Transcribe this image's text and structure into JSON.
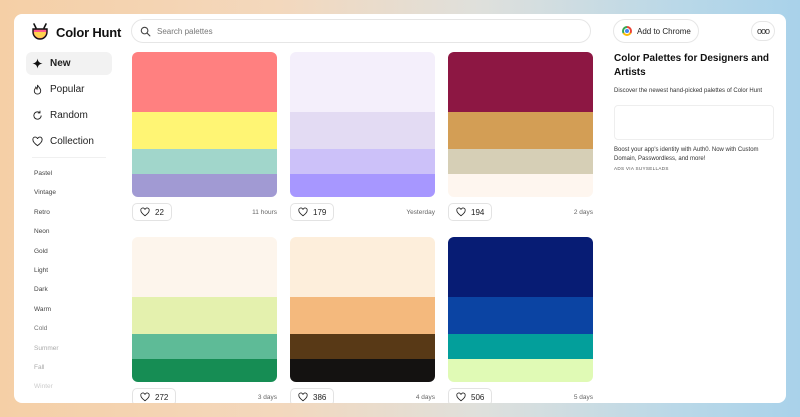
{
  "app": {
    "name": "Color Hunt"
  },
  "search": {
    "placeholder": "Search palettes"
  },
  "header": {
    "chrome_button": "Add to Chrome",
    "more_label": "ooo"
  },
  "sidebar": {
    "nav": [
      {
        "label": "New",
        "icon": "sparkle-icon",
        "active": true
      },
      {
        "label": "Popular",
        "icon": "flame-icon"
      },
      {
        "label": "Random",
        "icon": "refresh-icon"
      },
      {
        "label": "Collection",
        "icon": "heart-icon"
      }
    ],
    "tags": [
      "Pastel",
      "Vintage",
      "Retro",
      "Neon",
      "Gold",
      "Light",
      "Dark",
      "Warm",
      "Cold",
      "Summer",
      "Fall",
      "Winter"
    ]
  },
  "palettes": [
    {
      "colors": [
        "#ff8080",
        "#fff574",
        "#a1d6cb",
        "#a19ad3"
      ],
      "likes": "22",
      "time": "11 hours"
    },
    {
      "colors": [
        "#f4effb",
        "#e3dbf3",
        "#ccc1f9",
        "#a797ff"
      ],
      "likes": "179",
      "time": "Yesterday"
    },
    {
      "colors": [
        "#8d1743",
        "#d39e55",
        "#d6cfb6",
        "#fef6ef"
      ],
      "likes": "194",
      "time": "2 days"
    },
    {
      "colors": [
        "#fdf5ec",
        "#e4f1ae",
        "#5ebb97",
        "#168d54"
      ],
      "likes": "272",
      "time": "3 days"
    },
    {
      "colors": [
        "#fdeedb",
        "#f4b97d",
        "#583916",
        "#141211"
      ],
      "likes": "386",
      "time": "4 days"
    },
    {
      "colors": [
        "#071c74",
        "#0b44a3",
        "#039f9b",
        "#e0fab5"
      ],
      "likes": "506",
      "time": "5 days"
    }
  ],
  "right_panel": {
    "title": "Color Palettes for Designers and Artists",
    "description": "Discover the newest hand-picked palettes of Color Hunt",
    "ad_text": "Boost your app's identity with Auth0. Now with Custom Domain, Passwordless, and more!",
    "ad_via": "ADS VIA SUYSELLADS"
  }
}
